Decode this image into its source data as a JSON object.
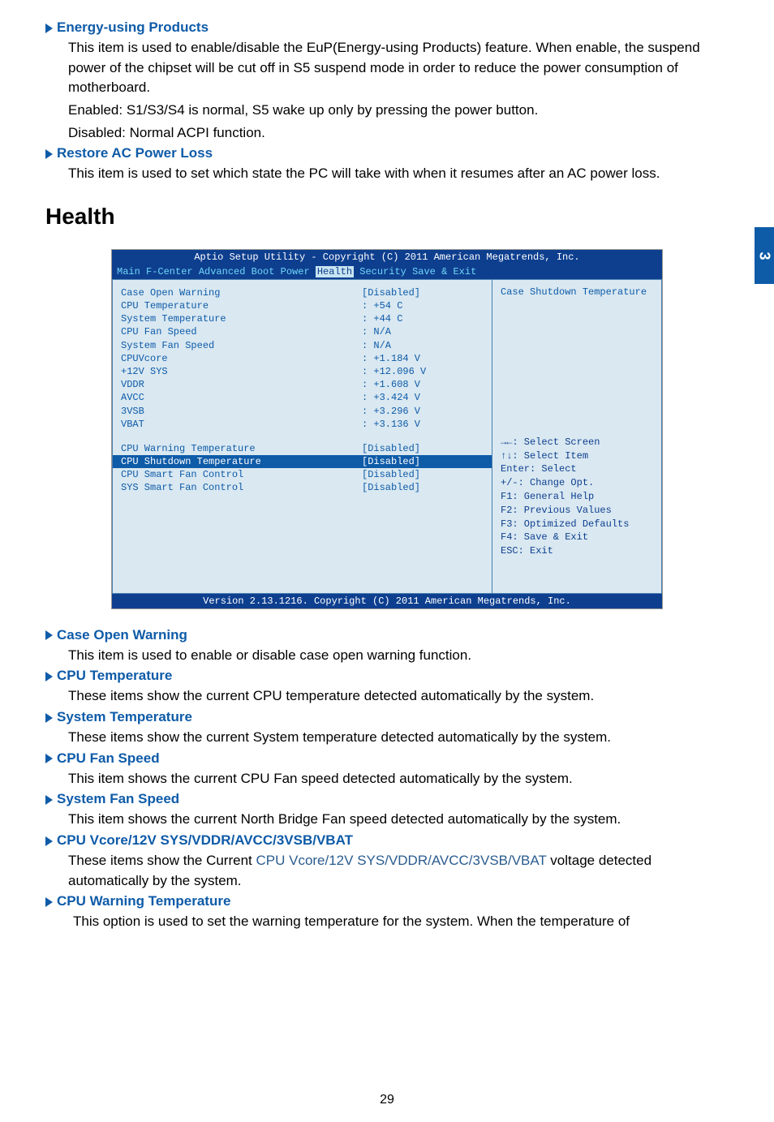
{
  "page_tab": "3",
  "sections": {
    "energy_products": {
      "title": "Energy-using Products",
      "p1": "This item is used to enable/disable the EuP(Energy-using Products) feature. When enable, the suspend power of the chipset will be cut off in S5 suspend mode in order to reduce the power consumption of motherboard.",
      "p2": "Enabled: S1/S3/S4 is normal, S5 wake up only by pressing the power button.",
      "p3": "Disabled: Normal ACPI function."
    },
    "restore_ac": {
      "title": "Restore AC Power Loss",
      "p1": "This item is used to set which state the PC will take with when it resumes after an AC power loss."
    },
    "health_heading": "Health"
  },
  "bios": {
    "header": "Aptio Setup Utility - Copyright (C) 2011 American Megatrends, Inc.",
    "menu": {
      "items_before": "Main  F-Center  Advanced  Boot  Power",
      "active": "Health",
      "items_after": "  Security  Save & Exit"
    },
    "rows1": [
      {
        "label": "Case Open Warning",
        "value": "[Disabled]"
      },
      {
        "label": "CPU Temperature",
        "value": ": +54 C"
      },
      {
        "label": "System Temperature",
        "value": ": +44 C"
      },
      {
        "label": "CPU Fan Speed",
        "value": ": N/A"
      },
      {
        "label": "System Fan Speed",
        "value": ": N/A"
      },
      {
        "label": "CPUVcore",
        "value": ": +1.184 V"
      },
      {
        "label": "+12V SYS",
        "value": ": +12.096 V"
      },
      {
        "label": "VDDR",
        "value": ": +1.608 V"
      },
      {
        "label": "AVCC",
        "value": ": +3.424 V"
      },
      {
        "label": "3VSB",
        "value": ": +3.296 V"
      },
      {
        "label": "VBAT",
        "value": ": +3.136 V"
      }
    ],
    "rows2": [
      {
        "label": "CPU Warning Temperature",
        "value": "[Disabled]",
        "selected": false
      },
      {
        "label": "CPU Shutdown Temperature",
        "value": "[Disabled]",
        "selected": true
      },
      {
        "label": "CPU Smart Fan Control",
        "value": "[Disabled]",
        "selected": false
      },
      {
        "label": "SYS Smart Fan Control",
        "value": "[Disabled]",
        "selected": false
      }
    ],
    "right_top": "Case Shutdown Temperature",
    "help": [
      "→←: Select Screen",
      "↑↓: Select Item",
      "Enter: Select",
      "+/-: Change Opt.",
      "F1: General Help",
      "F2: Previous Values",
      "F3: Optimized Defaults",
      "F4: Save & Exit",
      "ESC: Exit"
    ],
    "footer": "Version 2.13.1216. Copyright (C) 2011 American Megatrends, Inc."
  },
  "lower_sections": {
    "case_open": {
      "title": "Case Open Warning",
      "p": "This item is used to enable or disable case open warning function."
    },
    "cpu_temp": {
      "title": "CPU Temperature",
      "p": "These items show the current CPU temperature detected automatically by the system."
    },
    "sys_temp": {
      "title": "System Temperature",
      "p": "These items show the current System temperature detected automatically by the system."
    },
    "cpu_fan": {
      "title": "CPU Fan Speed",
      "p": "This item shows the current CPU Fan speed detected automatically by the system."
    },
    "sys_fan": {
      "title": "System Fan Speed",
      "p": "This item shows the current North Bridge Fan speed detected automatically by the system."
    },
    "vcore": {
      "title": "CPU Vcore/12V SYS/VDDR/AVCC/3VSB/VBAT",
      "p_pre": "These items show the Current ",
      "p_mid": "CPU Vcore/12V SYS/VDDR/AVCC/3VSB/VBAT",
      "p_post": " voltage detected automatically by the system."
    },
    "cpu_warning": {
      "title": "CPU Warning Temperature",
      "p": "This option is used to set the warning temperature for the system. When the temperature of"
    }
  },
  "page_number": "29"
}
